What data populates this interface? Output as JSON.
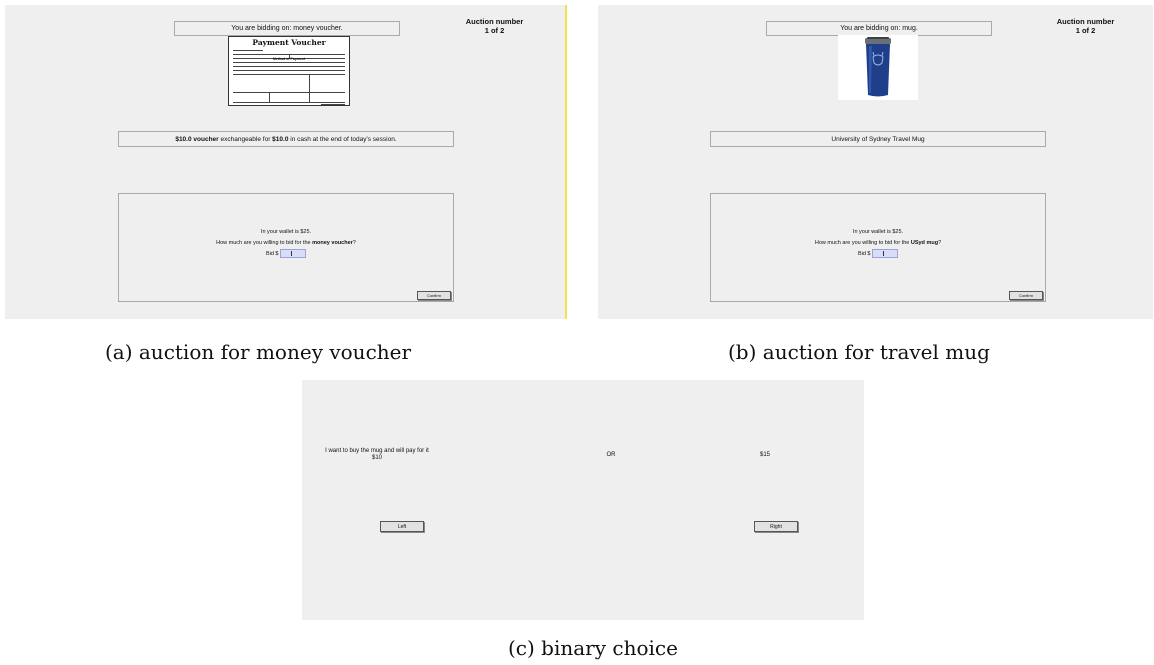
{
  "panel_a": {
    "bidding_on": "You are bidding on: money voucher.",
    "auction_number_label": "Auction number",
    "auction_number_value": "1 of 2",
    "voucher_image": {
      "title": "Payment Voucher",
      "section_heading": "Method of Payment"
    },
    "description_prefix_bold": "$10.0 voucher",
    "description_middle": " exchangeable for ",
    "description_amount_bold": "$10.0",
    "description_suffix": " in cash at the end of today's session.",
    "wallet_text": "In your wallet is $25.",
    "question_prefix": "How much are you willing to bid for the ",
    "question_item_bold": "money voucher",
    "question_suffix": "?",
    "bid_label": "Bid $",
    "bid_value": "",
    "confirm_label": "Confirm"
  },
  "panel_b": {
    "bidding_on": "You are bidding on: mug.",
    "auction_number_label": "Auction number",
    "auction_number_value": "1 of 2",
    "description": "University of Sydney Travel Mug",
    "wallet_text": "In your wallet is $25.",
    "question_prefix": "How much are you willing to bid for the ",
    "question_item_bold": "USyd mug",
    "question_suffix": "?",
    "bid_label": "Bid $",
    "bid_value": "",
    "confirm_label": "Confirm"
  },
  "panel_c": {
    "left_option_line1": "I want to buy the mug and will pay for it",
    "left_option_line2": "$10",
    "or_label": "OR",
    "right_option": "$15",
    "left_button": "Left",
    "right_button": "Right"
  },
  "captions": {
    "a": "(a) auction for money voucher",
    "b": "(b) auction for travel mug",
    "c": "(c) binary choice"
  },
  "colors": {
    "panel_bg": "#efefef",
    "input_bg": "#d9ddfa",
    "border": "#a9a9a9",
    "highlight_edge": "#f3e34a",
    "mug_blue": "#1f3f8a"
  }
}
